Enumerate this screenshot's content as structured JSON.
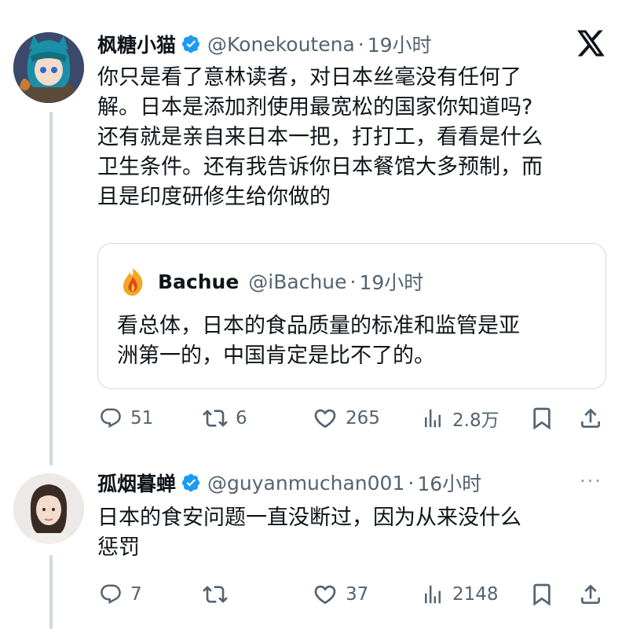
{
  "tweet1": {
    "display_name": "枫糖小猫",
    "handle": "@Konekoutena",
    "time": "19小时",
    "lines": [
      "你只是看了意林读者，对日本丝毫没有任何了",
      "解。日本是添加剂使用最宽松的国家你知道吗?",
      "还有就是亲自来日本一把，打打工，看看是什么",
      "卫生条件。还有我告诉你日本餐馆大多预制，而",
      "且是印度研修生给你做的"
    ],
    "quote": {
      "display_name": "Bachue",
      "handle": "@iBachue",
      "time": "19小时",
      "lines": [
        "看总体，日本的食品质量的标准和监管是亚",
        "洲第一的，中国肯定是比不了的。"
      ]
    },
    "actions": {
      "replies": "51",
      "retweets": "6",
      "likes": "265",
      "views": "2.8万"
    }
  },
  "tweet2": {
    "display_name": "孤烟暮蝉",
    "handle": "@guyanmuchan001",
    "time": "16小时",
    "lines": [
      "日本的食安问题一直没断过，因为从来没什么",
      "惩罚"
    ],
    "actions": {
      "replies": "7",
      "retweets": "",
      "likes": "37",
      "views": "2148"
    }
  },
  "separator": "·",
  "more_glyph": "···",
  "colors": {
    "verified": "#1d9bf0",
    "text": "#0f1419",
    "secondary": "#536471",
    "border": "#cfd9de"
  },
  "icons": [
    "x-logo-icon",
    "verified-badge-icon",
    "reply-icon",
    "retweet-icon",
    "like-icon",
    "views-icon",
    "bookmark-icon",
    "share-icon",
    "more-icon"
  ]
}
